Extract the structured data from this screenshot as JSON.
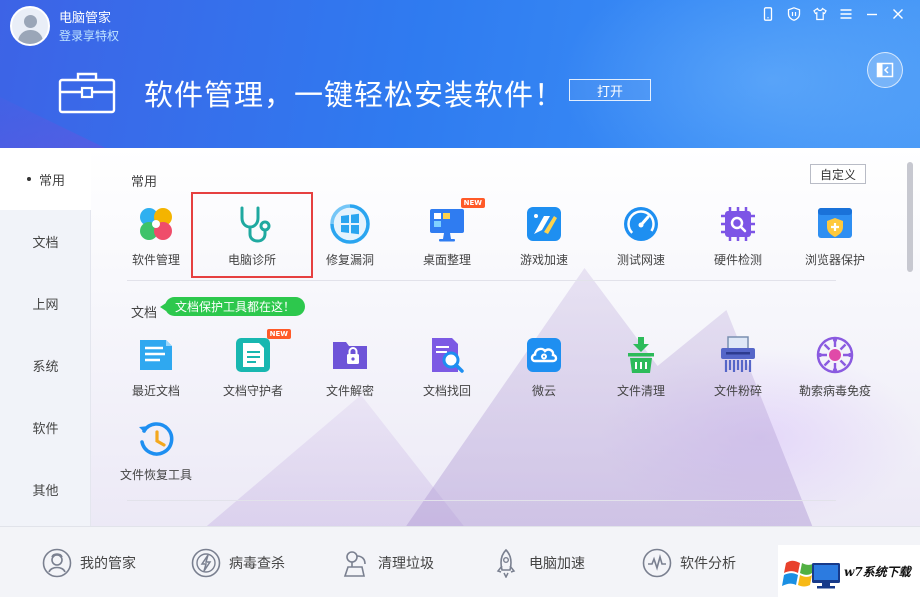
{
  "header": {
    "app_title": "电脑管家",
    "login_link": "登录享特权",
    "banner_text": "软件管理，一键轻松安装软件！",
    "banner_button": "打开",
    "icons": [
      "phone-icon",
      "shield-icon",
      "skin-icon",
      "menu-icon",
      "minimize-icon",
      "close-icon"
    ]
  },
  "sidebar": {
    "items": [
      {
        "label": "常用",
        "active": true
      },
      {
        "label": "文档"
      },
      {
        "label": "上网"
      },
      {
        "label": "系统"
      },
      {
        "label": "软件"
      },
      {
        "label": "其他"
      }
    ]
  },
  "main": {
    "custom_button": "自定义",
    "sections": [
      {
        "title": "常用",
        "tools": [
          {
            "label": "软件管理",
            "icon": "clover-icon"
          },
          {
            "label": "电脑诊所",
            "icon": "stethoscope-icon",
            "selected": true
          },
          {
            "label": "修复漏洞",
            "icon": "windows-repair-icon"
          },
          {
            "label": "桌面整理",
            "icon": "desktop-icon",
            "badge": "NEW"
          },
          {
            "label": "游戏加速",
            "icon": "game-boost-icon"
          },
          {
            "label": "测试网速",
            "icon": "speedometer-icon"
          },
          {
            "label": "硬件检测",
            "icon": "chip-icon"
          },
          {
            "label": "浏览器保护",
            "icon": "browser-shield-icon"
          }
        ]
      },
      {
        "title": "文档",
        "badge": "文档保护工具都在这！",
        "tools": [
          {
            "label": "最近文档",
            "icon": "recent-doc-icon"
          },
          {
            "label": "文档守护者",
            "icon": "doc-guard-icon",
            "badge": "NEW"
          },
          {
            "label": "文件解密",
            "icon": "folder-lock-icon"
          },
          {
            "label": "文档找回",
            "icon": "doc-search-icon"
          },
          {
            "label": "微云",
            "icon": "cloud-icon"
          },
          {
            "label": "文件清理",
            "icon": "trash-icon"
          },
          {
            "label": "文件粉碎",
            "icon": "shredder-icon"
          },
          {
            "label": "勒索病毒免疫",
            "icon": "virus-icon"
          },
          {
            "label": "文件恢复工具",
            "icon": "restore-icon"
          }
        ]
      }
    ]
  },
  "bottombar": {
    "items": [
      {
        "label": "我的管家",
        "icon": "butler-icon"
      },
      {
        "label": "病毒查杀",
        "icon": "lightning-shield-icon"
      },
      {
        "label": "清理垃圾",
        "icon": "vacuum-icon"
      },
      {
        "label": "电脑加速",
        "icon": "rocket-icon"
      },
      {
        "label": "软件分析",
        "icon": "software-analysis-icon"
      }
    ],
    "watermark_text": "w7系统下载"
  }
}
